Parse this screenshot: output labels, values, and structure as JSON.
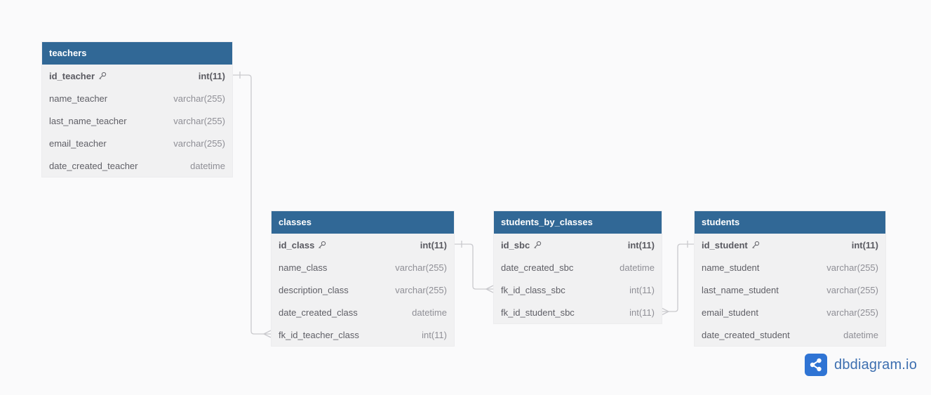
{
  "tables": [
    {
      "id": "teachers",
      "name": "teachers",
      "fields": [
        {
          "name": "id_teacher",
          "type": "int(11)",
          "pk": true
        },
        {
          "name": "name_teacher",
          "type": "varchar(255)",
          "pk": false
        },
        {
          "name": "last_name_teacher",
          "type": "varchar(255)",
          "pk": false
        },
        {
          "name": "email_teacher",
          "type": "varchar(255)",
          "pk": false
        },
        {
          "name": "date_created_teacher",
          "type": "datetime",
          "pk": false
        }
      ]
    },
    {
      "id": "classes",
      "name": "classes",
      "fields": [
        {
          "name": "id_class",
          "type": "int(11)",
          "pk": true
        },
        {
          "name": "name_class",
          "type": "varchar(255)",
          "pk": false
        },
        {
          "name": "description_class",
          "type": "varchar(255)",
          "pk": false
        },
        {
          "name": "date_created_class",
          "type": "datetime",
          "pk": false
        },
        {
          "name": "fk_id_teacher_class",
          "type": "int(11)",
          "pk": false
        }
      ]
    },
    {
      "id": "students_by_classes",
      "name": "students_by_classes",
      "fields": [
        {
          "name": "id_sbc",
          "type": "int(11)",
          "pk": true
        },
        {
          "name": "date_created_sbc",
          "type": "datetime",
          "pk": false
        },
        {
          "name": "fk_id_class_sbc",
          "type": "int(11)",
          "pk": false
        },
        {
          "name": "fk_id_student_sbc",
          "type": "int(11)",
          "pk": false
        }
      ]
    },
    {
      "id": "students",
      "name": "students",
      "fields": [
        {
          "name": "id_student",
          "type": "int(11)",
          "pk": true
        },
        {
          "name": "name_student",
          "type": "varchar(255)",
          "pk": false
        },
        {
          "name": "last_name_student",
          "type": "varchar(255)",
          "pk": false
        },
        {
          "name": "email_student",
          "type": "varchar(255)",
          "pk": false
        },
        {
          "name": "date_created_student",
          "type": "datetime",
          "pk": false
        }
      ]
    }
  ],
  "relationships": [
    {
      "from": "teachers.id_teacher",
      "to": "classes.fk_id_teacher_class",
      "cardinality": "one-to-many"
    },
    {
      "from": "classes.id_class",
      "to": "students_by_classes.fk_id_class_sbc",
      "cardinality": "one-to-many"
    },
    {
      "from": "students.id_student",
      "to": "students_by_classes.fk_id_student_sbc",
      "cardinality": "one-to-many"
    }
  ],
  "brand": {
    "text": "dbdiagram.io",
    "icon": "share-icon"
  },
  "colors": {
    "header": "#316896",
    "table_bg": "#f1f1f2",
    "connector": "#c9c9cd",
    "brand": "#2f74d4"
  }
}
